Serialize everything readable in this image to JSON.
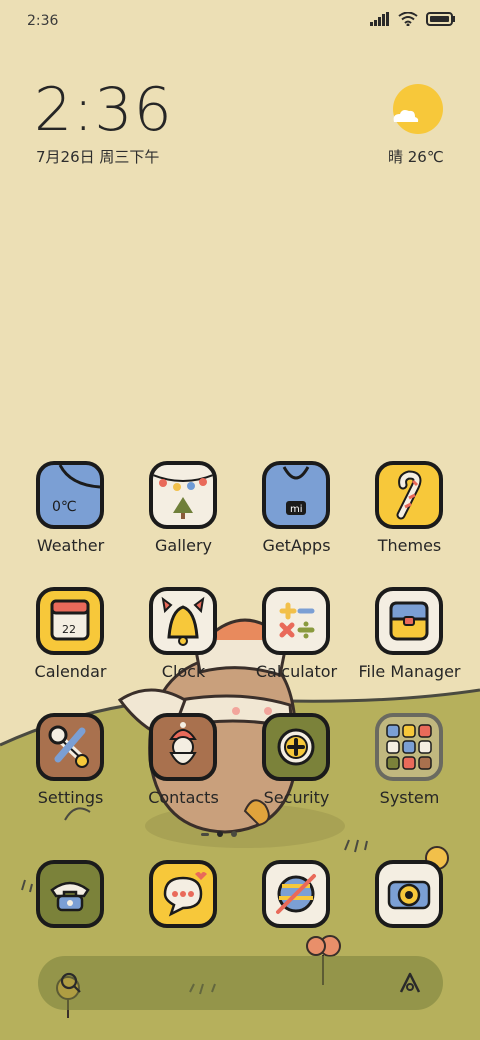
{
  "status_bar": {
    "time": "2:36"
  },
  "clock_widget": {
    "time": "2:36",
    "date": "7月26日 周三下午"
  },
  "weather_widget": {
    "text": "晴 26℃"
  },
  "apps_row1": [
    {
      "label": "Weather"
    },
    {
      "label": "Gallery"
    },
    {
      "label": "GetApps"
    },
    {
      "label": "Themes"
    }
  ],
  "apps_row2": [
    {
      "label": "Calendar"
    },
    {
      "label": "Clock"
    },
    {
      "label": "Calculator"
    },
    {
      "label": "File Manager"
    }
  ],
  "apps_row3": [
    {
      "label": "Settings"
    },
    {
      "label": "Contacts"
    },
    {
      "label": "Security"
    },
    {
      "label": "System"
    }
  ],
  "weather_icon_text": "0℃",
  "calendar_icon_text": "22",
  "getapps_icon_text": "mi",
  "dock": [
    "phone-icon",
    "messages-icon",
    "browser-icon",
    "camera-icon"
  ],
  "colors": {
    "background": "#ecdfb5",
    "grass": "#b8b35e",
    "icon_border": "#1b1b1b"
  }
}
